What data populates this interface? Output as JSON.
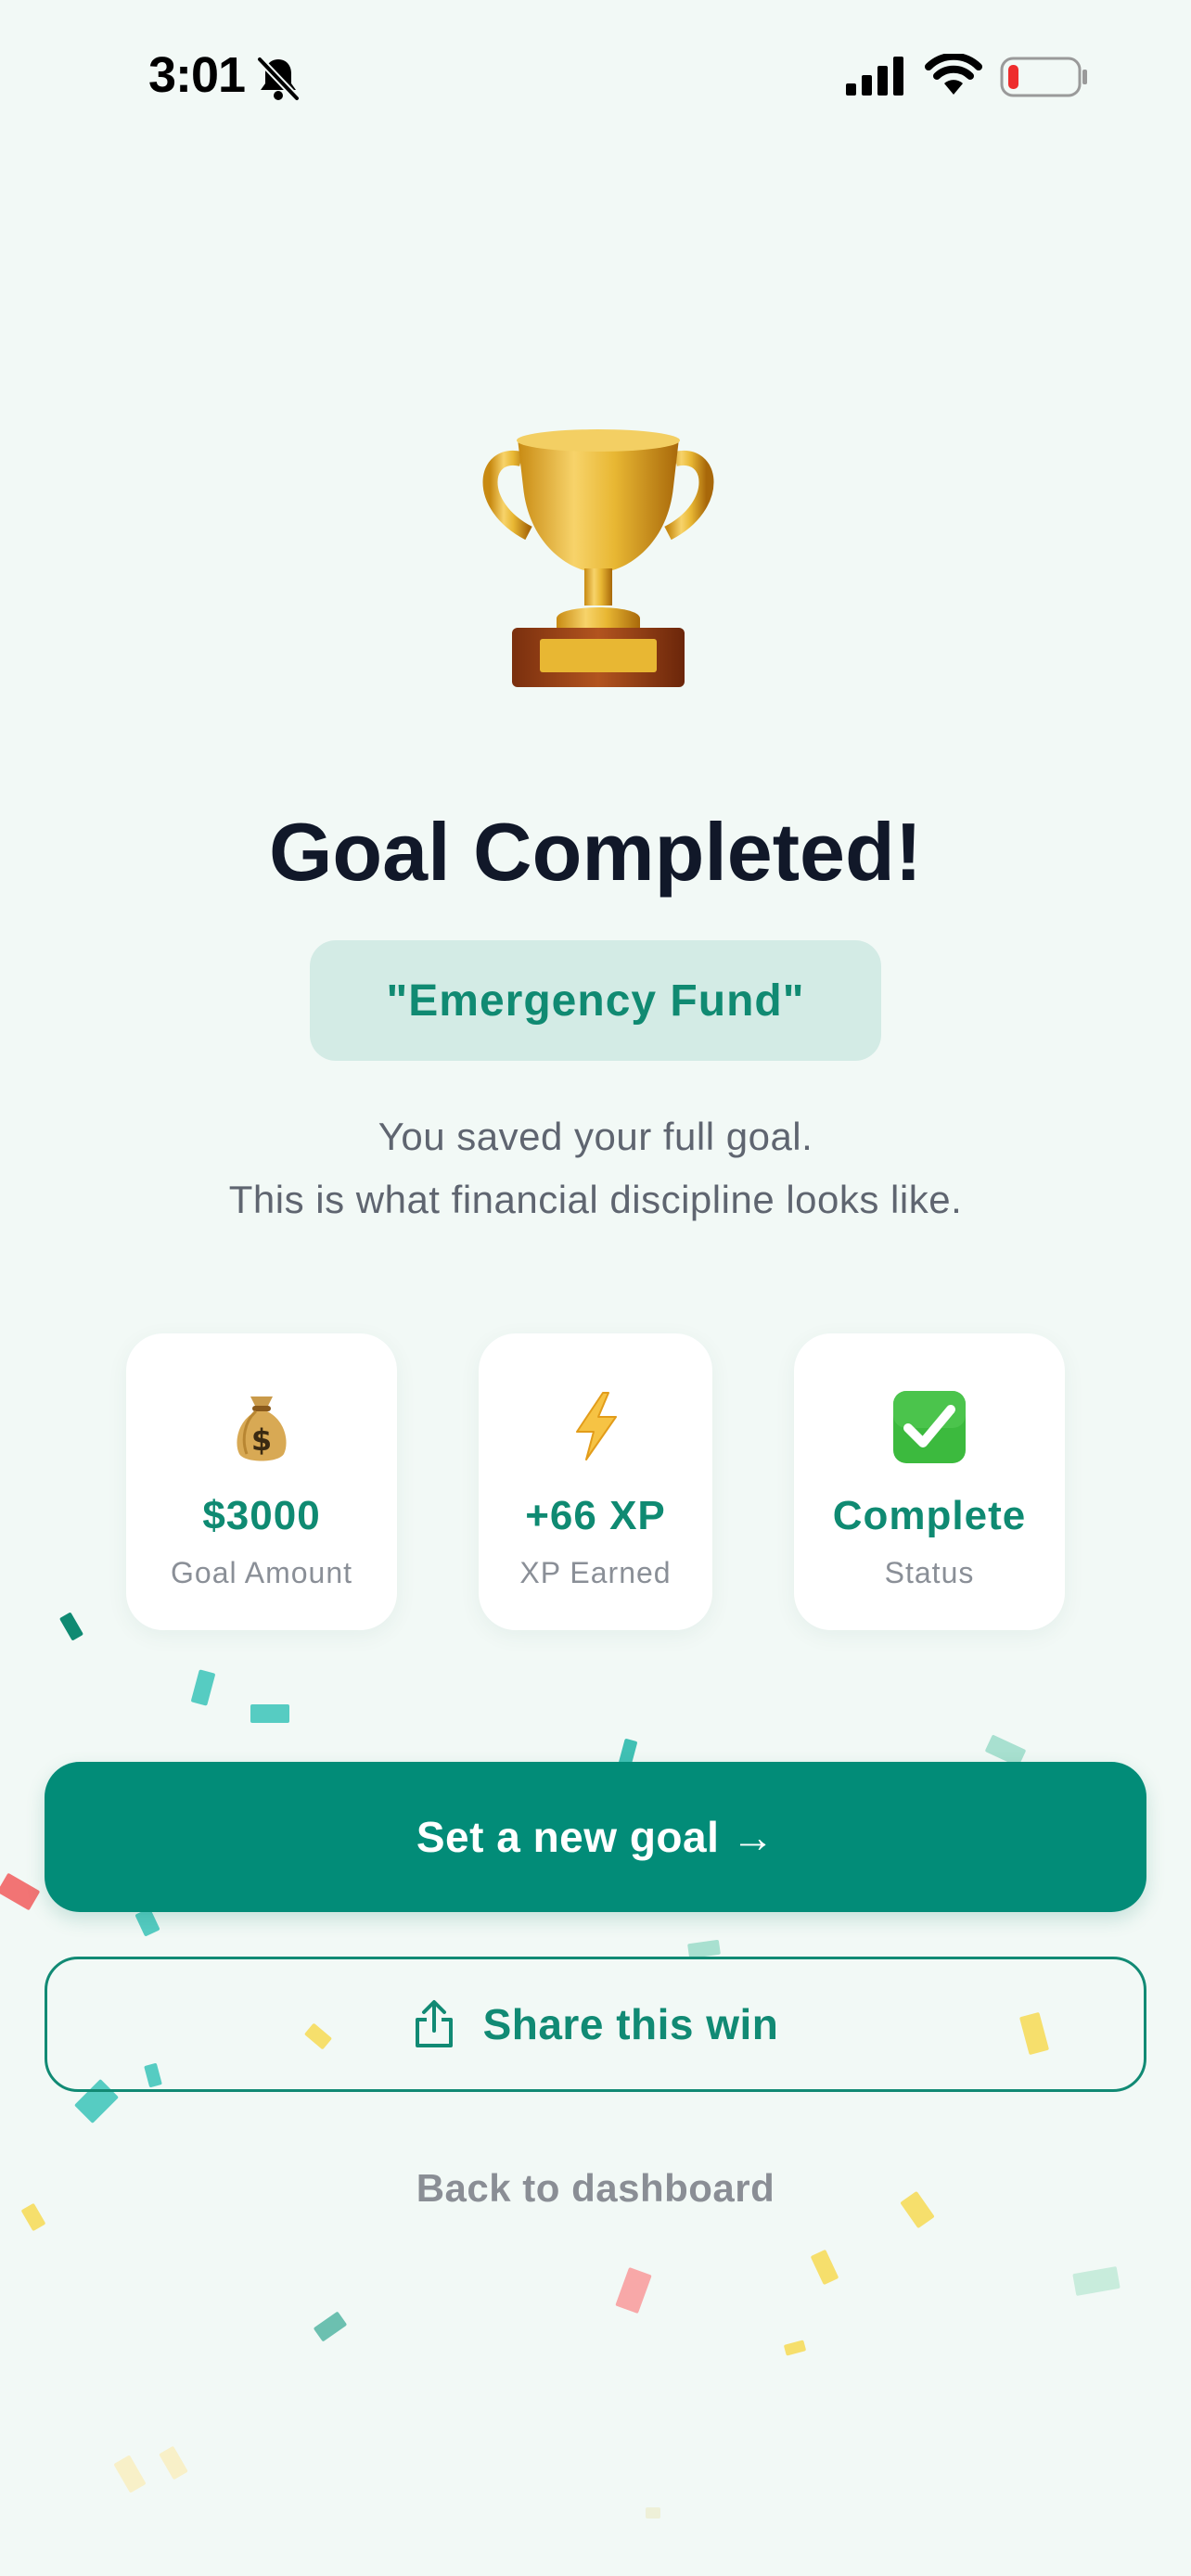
{
  "status_bar": {
    "time": "3:01"
  },
  "title": "Goal Completed!",
  "goal_name": "\"Emergency Fund\"",
  "subtitle_line1": "You saved your full goal.",
  "subtitle_line2": "This is what financial discipline looks like.",
  "stats": [
    {
      "icon": "money-bag-icon",
      "value": "$3000",
      "label": "Goal Amount"
    },
    {
      "icon": "lightning-icon",
      "value": "+66 XP",
      "label": "XP Earned"
    },
    {
      "icon": "check-mark-icon",
      "value": "Complete",
      "label": "Status"
    }
  ],
  "actions": {
    "primary_label": "Set a new goal →",
    "share_label": "Share this win",
    "back_label": "Back to dashboard"
  },
  "colors": {
    "accent": "#028c78",
    "background": "#f2f9f6",
    "chip": "#d3ebe5"
  }
}
